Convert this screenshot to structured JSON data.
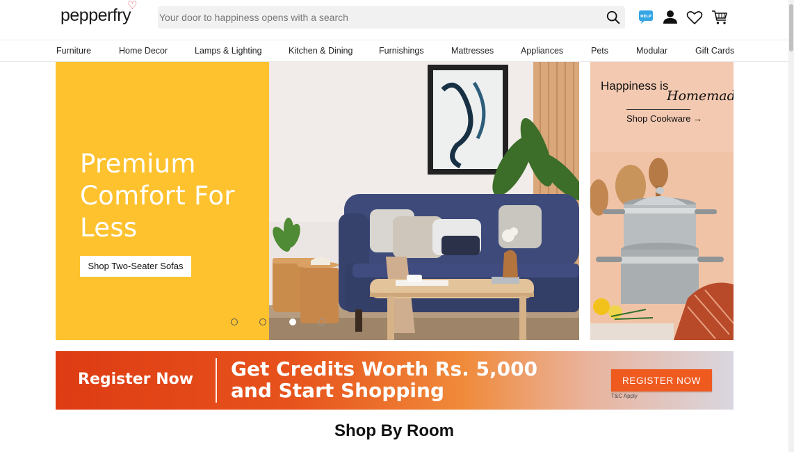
{
  "header": {
    "logo_text": "pepperfry",
    "search_placeholder": "Your door to happiness opens with a search",
    "help_badge": "HELP",
    "icons": [
      "search-icon",
      "help-icon",
      "user-icon",
      "heart-icon",
      "cart-icon"
    ]
  },
  "nav": {
    "items": [
      "Furniture",
      "Home Decor",
      "Lamps & Lighting",
      "Kitchen & Dining",
      "Furnishings",
      "Mattresses",
      "Appliances",
      "Pets",
      "Modular",
      "Gift Cards"
    ]
  },
  "hero": {
    "title": "Premium Comfort For Less",
    "cta_label": "Shop Two-Seater Sofas",
    "slide_count": 4,
    "active_slide": 3,
    "accent_color": "#fec22f"
  },
  "side_banner": {
    "title_part1": "Happiness is",
    "title_part2": "Homemade",
    "link_label": "Shop Cookware →"
  },
  "register_banner": {
    "left_label": "Register Now",
    "headline_line1": "Get Credits Worth Rs. 5,000",
    "headline_line2": "and Start Shopping",
    "button_label": "REGISTER NOW",
    "tc_text": "T&C Apply",
    "button_color": "#ef5a1f"
  },
  "main": {
    "section_title": "Shop By Room"
  }
}
